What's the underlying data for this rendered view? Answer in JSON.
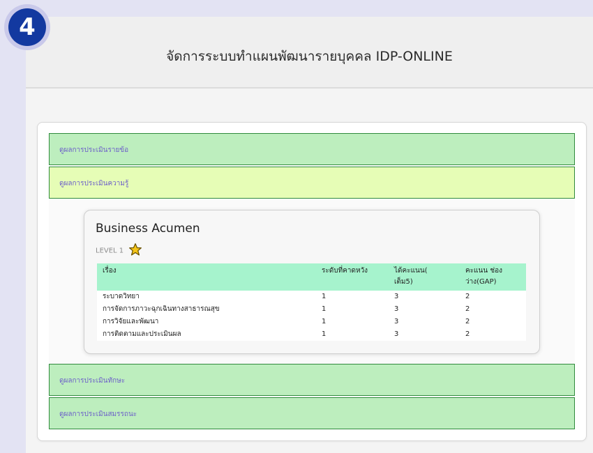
{
  "badge": {
    "step_number": "4"
  },
  "header": {
    "title": "จัดการระบบทำแผนพัฒนารายบุคคล IDP-ONLINE"
  },
  "sections": [
    {
      "label": "ดูผลการประเมินรายข้อ",
      "color": "#bdeebe"
    },
    {
      "label": "ดูผลการประเมินความรู้",
      "color": "#e6fdb6"
    },
    {
      "label": "ดูผลการประเมินทักษะ",
      "color": "#bdeebe"
    },
    {
      "label": "ดูผลการประเมินสมรรถนะ",
      "color": "#bdeebe"
    }
  ],
  "detail": {
    "title": "Business Acumen",
    "level_label": "LEVEL 1",
    "level_icon": "star-icon",
    "table": {
      "headers": [
        "เรื่อง",
        "ระดับที่คาดหวัง",
        "ได้คะแนน(\nเต็ม5)",
        "คะแนน ช่อง\nว่าง(GAP)"
      ],
      "rows": [
        [
          "ระบาดวิทยา",
          "1",
          "3",
          "2"
        ],
        [
          "การจัดการภาวะฉุกเฉินทางสาธารณสุข",
          "1",
          "3",
          "2"
        ],
        [
          "การวิจัยและพัฒนา",
          "1",
          "3",
          "2"
        ],
        [
          "การติดตามและประเมินผล",
          "1",
          "3",
          "2"
        ]
      ]
    }
  },
  "colors": {
    "accent_badge": "#1339a0",
    "table_header": "#a6f3cd",
    "bar_border": "#2f8a3c",
    "link_text": "#6c5fc9",
    "star_fill": "#f5c518"
  }
}
